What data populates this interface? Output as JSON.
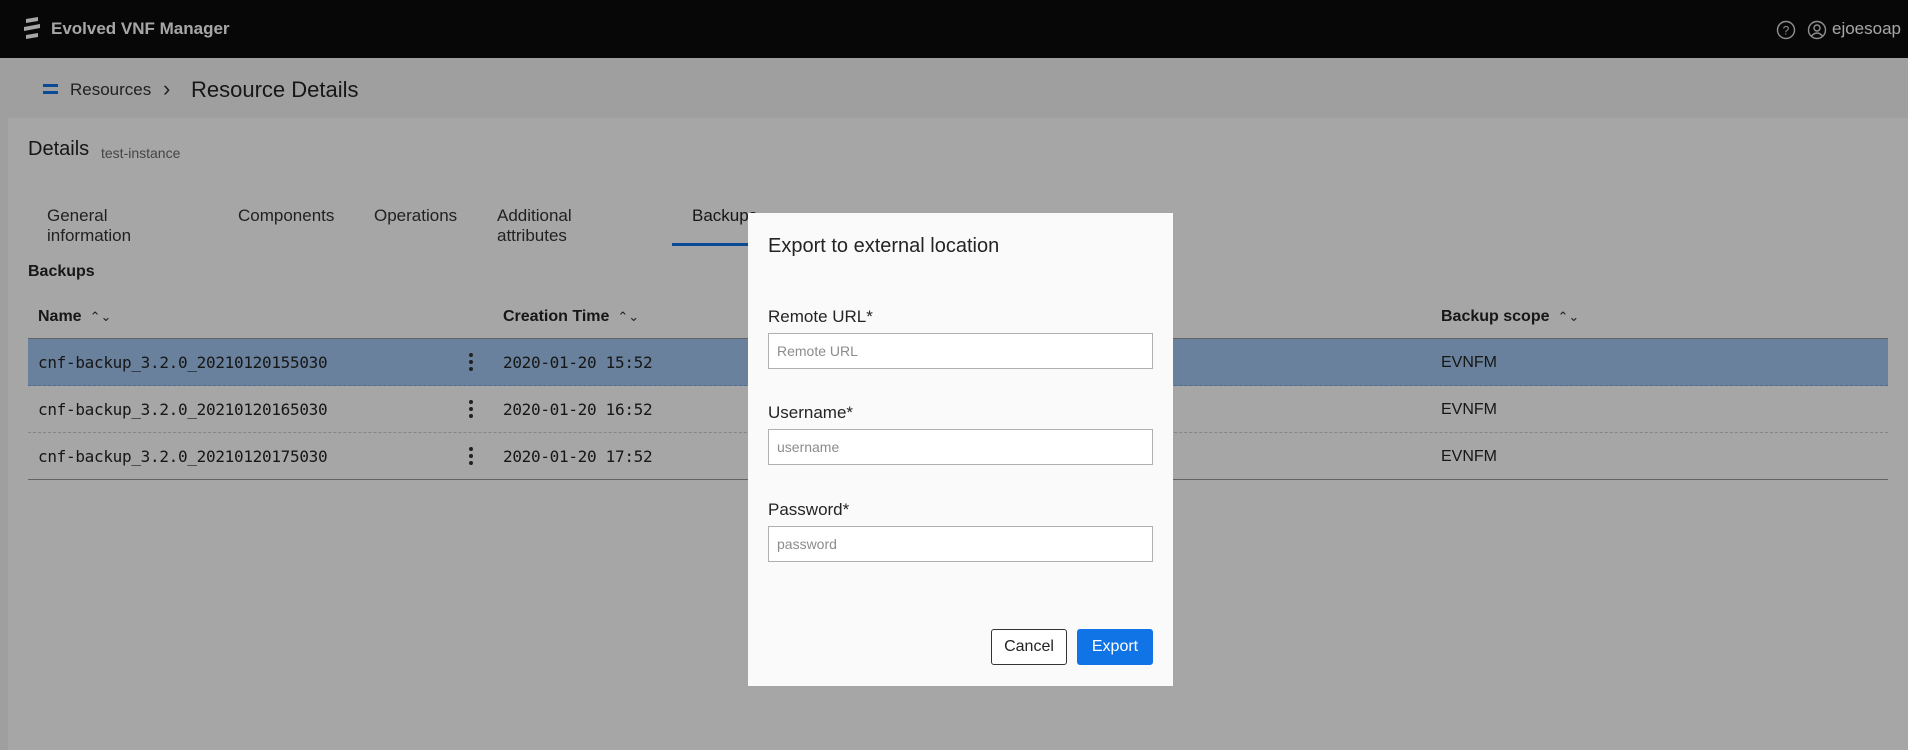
{
  "app": {
    "title": "Evolved VNF Manager",
    "username": "ejoesoap",
    "accent_color": "#1174e6"
  },
  "breadcrumb": {
    "parent": "Resources",
    "current": "Resource Details"
  },
  "details": {
    "title": "Details",
    "subtitle": "test-instance"
  },
  "tabs": [
    {
      "label": "General information"
    },
    {
      "label": "Components"
    },
    {
      "label": "Operations"
    },
    {
      "label": "Additional attributes"
    },
    {
      "label": "Backups",
      "active": true
    }
  ],
  "backups": {
    "title": "Backups",
    "columns": [
      "Name",
      "Creation Time",
      "Backup scope"
    ],
    "rows": [
      {
        "name": "cnf-backup_3.2.0_20210120155030",
        "creation_time": "2020-01-20 15:52",
        "scope": "EVNFM",
        "selected": true
      },
      {
        "name": "cnf-backup_3.2.0_20210120165030",
        "creation_time": "2020-01-20 16:52",
        "scope": "EVNFM"
      },
      {
        "name": "cnf-backup_3.2.0_20210120175030",
        "creation_time": "2020-01-20 17:52",
        "scope": "EVNFM"
      }
    ]
  },
  "dialog": {
    "title": "Export to external location",
    "fields": [
      {
        "label": "Remote URL*",
        "placeholder": "Remote URL",
        "value": ""
      },
      {
        "label": "Username*",
        "placeholder": "username",
        "value": ""
      },
      {
        "label": "Password*",
        "placeholder": "password",
        "value": ""
      }
    ],
    "cancel_label": "Cancel",
    "export_label": "Export"
  }
}
